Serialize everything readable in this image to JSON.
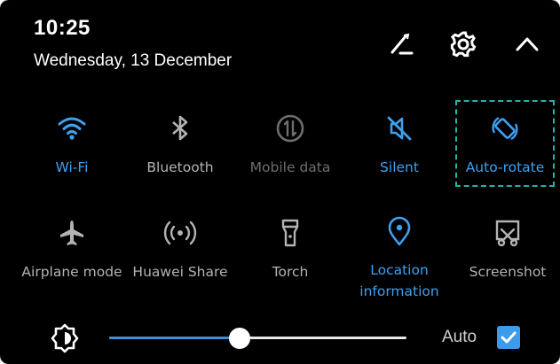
{
  "header": {
    "time": "10:25",
    "date": "Wednesday, 13 December",
    "icons": [
      "edit-icon",
      "settings-icon",
      "collapse-icon"
    ]
  },
  "tiles": [
    {
      "label": "Wi-Fi",
      "icon": "wifi-icon",
      "state": "on"
    },
    {
      "label": "Bluetooth",
      "icon": "bluetooth-icon",
      "state": "off"
    },
    {
      "label": "Mobile data",
      "icon": "mobile-data-icon",
      "state": "disabled"
    },
    {
      "label": "Silent",
      "icon": "silent-icon",
      "state": "on"
    },
    {
      "label": "Auto-rotate",
      "icon": "auto-rotate-icon",
      "state": "on",
      "highlighted": true
    },
    {
      "label": "Airplane mode",
      "icon": "airplane-icon",
      "state": "off"
    },
    {
      "label": "Huawei Share",
      "icon": "huawei-share-icon",
      "state": "off"
    },
    {
      "label": "Torch",
      "icon": "torch-icon",
      "state": "off"
    },
    {
      "label": "Location information",
      "label_line1": "Location",
      "label_line2": "information",
      "icon": "location-icon",
      "state": "on"
    },
    {
      "label": "Screenshot",
      "icon": "screenshot-icon",
      "state": "off"
    }
  ],
  "brightness": {
    "icon": "brightness-icon",
    "level": 0.44,
    "auto_label": "Auto",
    "auto_checked": true
  },
  "colors": {
    "background": "#000000",
    "active": "#3ea0f0",
    "inactive": "#b3b3b3",
    "disabled": "#6e6e6e",
    "highlight_border": "#1fb5a8"
  }
}
